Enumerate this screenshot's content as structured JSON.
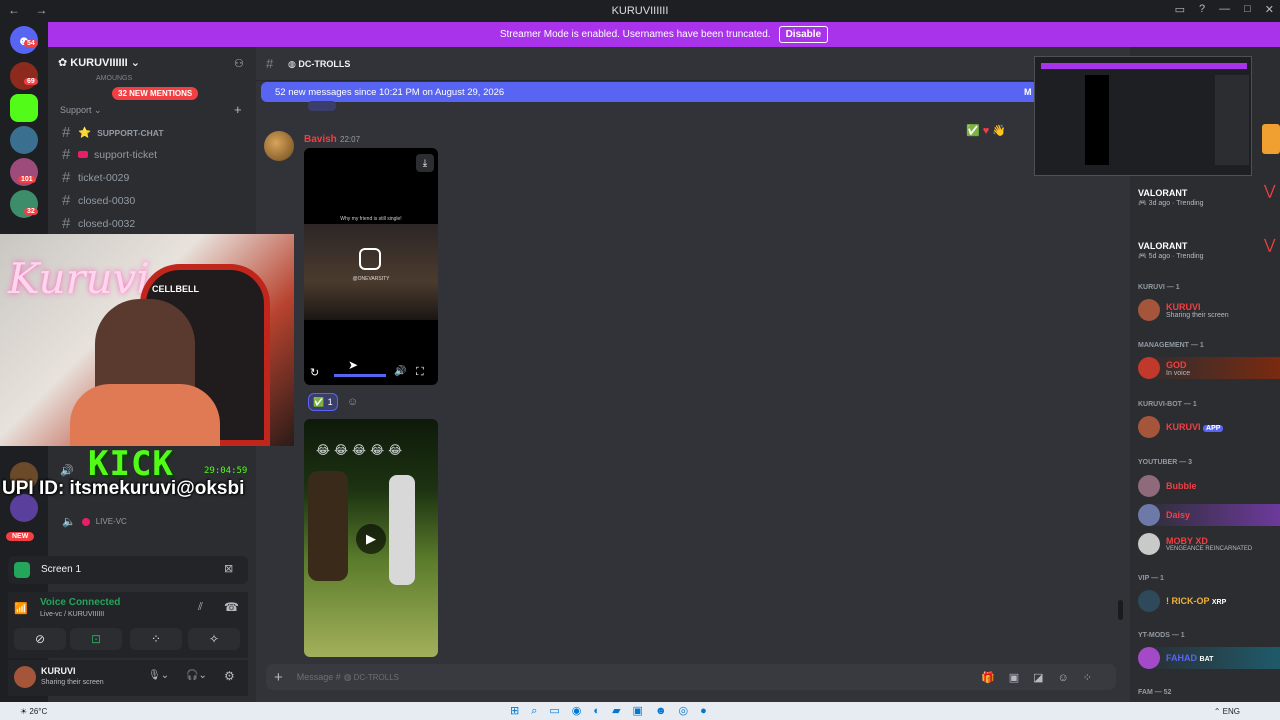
{
  "window": {
    "title": "KURUVIIIIII"
  },
  "banner": {
    "text": "Streamer Mode is enabled. Usernames have been truncated.",
    "button": "Disable"
  },
  "rail": {
    "home_badge": "54",
    "badges": [
      "69",
      "101",
      "32"
    ],
    "new_label": "NEW"
  },
  "server": {
    "name": "KURUVIIIIII",
    "mentions": "32 NEW MENTIONS"
  },
  "channels": {
    "partial": "AMOUNGS",
    "category": "Support",
    "items": [
      {
        "emoji": "⭐",
        "label": "SUPPORT-CHAT"
      },
      {
        "emoji": "",
        "label": "support-ticket"
      },
      {
        "emoji": "",
        "label": "ticket-0029"
      },
      {
        "emoji": "",
        "label": "closed-0030"
      },
      {
        "emoji": "",
        "label": "closed-0032"
      }
    ],
    "voice_channel": "LIVE-VC"
  },
  "overlay": {
    "kick": "KICK",
    "timer": "29:04:59",
    "upi": "UPI ID: itsmekuruvi@oksbi",
    "cam_logo": "CELLBELL"
  },
  "panels": {
    "screen_label": "Screen 1",
    "voice_status": "Voice Connected",
    "voice_channel": "Live-vc / KURUVIIIIII",
    "user_name": "KURUVI",
    "user_status": "Sharing their screen"
  },
  "chat": {
    "channel": "DC-TROLLS",
    "new_messages": "52 new messages since 10:21 PM on August 29, 2026",
    "new_messages_tail": "M",
    "author": "Bavish",
    "time": "22:07",
    "video1_caption": "Why my friend is still single!",
    "video1_handle": "@ONEVARSITY",
    "reaction_count": "1",
    "input_placeholder": "Message #",
    "input_channel": "DC-TROLLS"
  },
  "members": {
    "activities": [
      {
        "game": "VALORANT",
        "when": "3d ago",
        "tag": "Trending"
      },
      {
        "game": "VALORANT",
        "when": "5d ago",
        "tag": "Trending"
      }
    ],
    "groups": [
      {
        "header": "KURUVI — 1",
        "members": [
          {
            "name": "KURUVI",
            "status": "Sharing their screen",
            "color": "#f23f43"
          }
        ]
      },
      {
        "header": "MANAGEMENT — 1",
        "members": [
          {
            "name": "GOD",
            "status": "In voice",
            "color": "#f23f43"
          }
        ]
      },
      {
        "header": "KURUVI-BOT — 1",
        "members": [
          {
            "name": "KURUVI",
            "status": "",
            "color": "#f23f43",
            "tag": "APP"
          }
        ]
      },
      {
        "header": "YOUTUBER — 3",
        "members": [
          {
            "name": "Bubble",
            "status": "",
            "color": "#f23f43"
          },
          {
            "name": "Daisy",
            "status": "",
            "color": "#f23f43"
          },
          {
            "name": "MOBY XD",
            "status": "VENGEANCE REINCARNATED",
            "color": "#f23f43"
          }
        ]
      },
      {
        "header": "VIP — 1",
        "members": [
          {
            "name": "! RICK-OP",
            "status": "",
            "color": "#f0b232",
            "tag": "XRP"
          }
        ]
      },
      {
        "header": "YT-MODS — 1",
        "members": [
          {
            "name": "FAHAD",
            "status": "",
            "color": "#5865f2",
            "tag": "BAT"
          }
        ]
      },
      {
        "header": "FAM — 52",
        "members": []
      }
    ]
  },
  "taskbar": {
    "weather": "26°C",
    "lang": "ENG"
  }
}
